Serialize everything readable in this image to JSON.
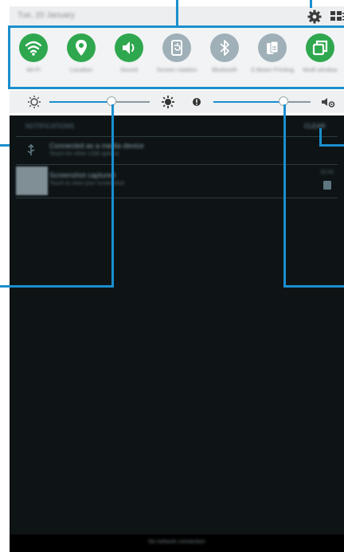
{
  "statusbar": {
    "date_text": "Tue, 20 January"
  },
  "quick_settings": [
    {
      "label": "Wi-Fi",
      "icon": "wifi-icon",
      "state": "on"
    },
    {
      "label": "Location",
      "icon": "location-icon",
      "state": "on"
    },
    {
      "label": "Sound",
      "icon": "sound-icon",
      "state": "on"
    },
    {
      "label": "Screen rotation",
      "icon": "screen-rotation-icon",
      "state": "off"
    },
    {
      "label": "Bluetooth",
      "icon": "bluetooth-icon",
      "state": "off"
    },
    {
      "label": "S Beam Printing",
      "icon": "s-beam-icon",
      "state": "off"
    },
    {
      "label": "Multi window",
      "icon": "multi-window-icon",
      "state": "on"
    }
  ],
  "sliders": {
    "brightness_level": 0.62,
    "volume_level": 0.72
  },
  "notifications": {
    "title": "NOTIFICATIONS",
    "clear_label": "CLEAR",
    "items": [
      {
        "title": "Connected as a media device",
        "subtitle": "Touch for other USB options"
      },
      {
        "title": "Screenshot captured",
        "subtitle": "Touch to view your screenshot",
        "time": "10:41"
      }
    ]
  },
  "bottom_bar": {
    "text": "No network connection"
  },
  "colors": {
    "active": "#2fa74e",
    "inactive": "#9fb0b8",
    "callout": "#1a8fce",
    "panel": "#0e1416"
  }
}
